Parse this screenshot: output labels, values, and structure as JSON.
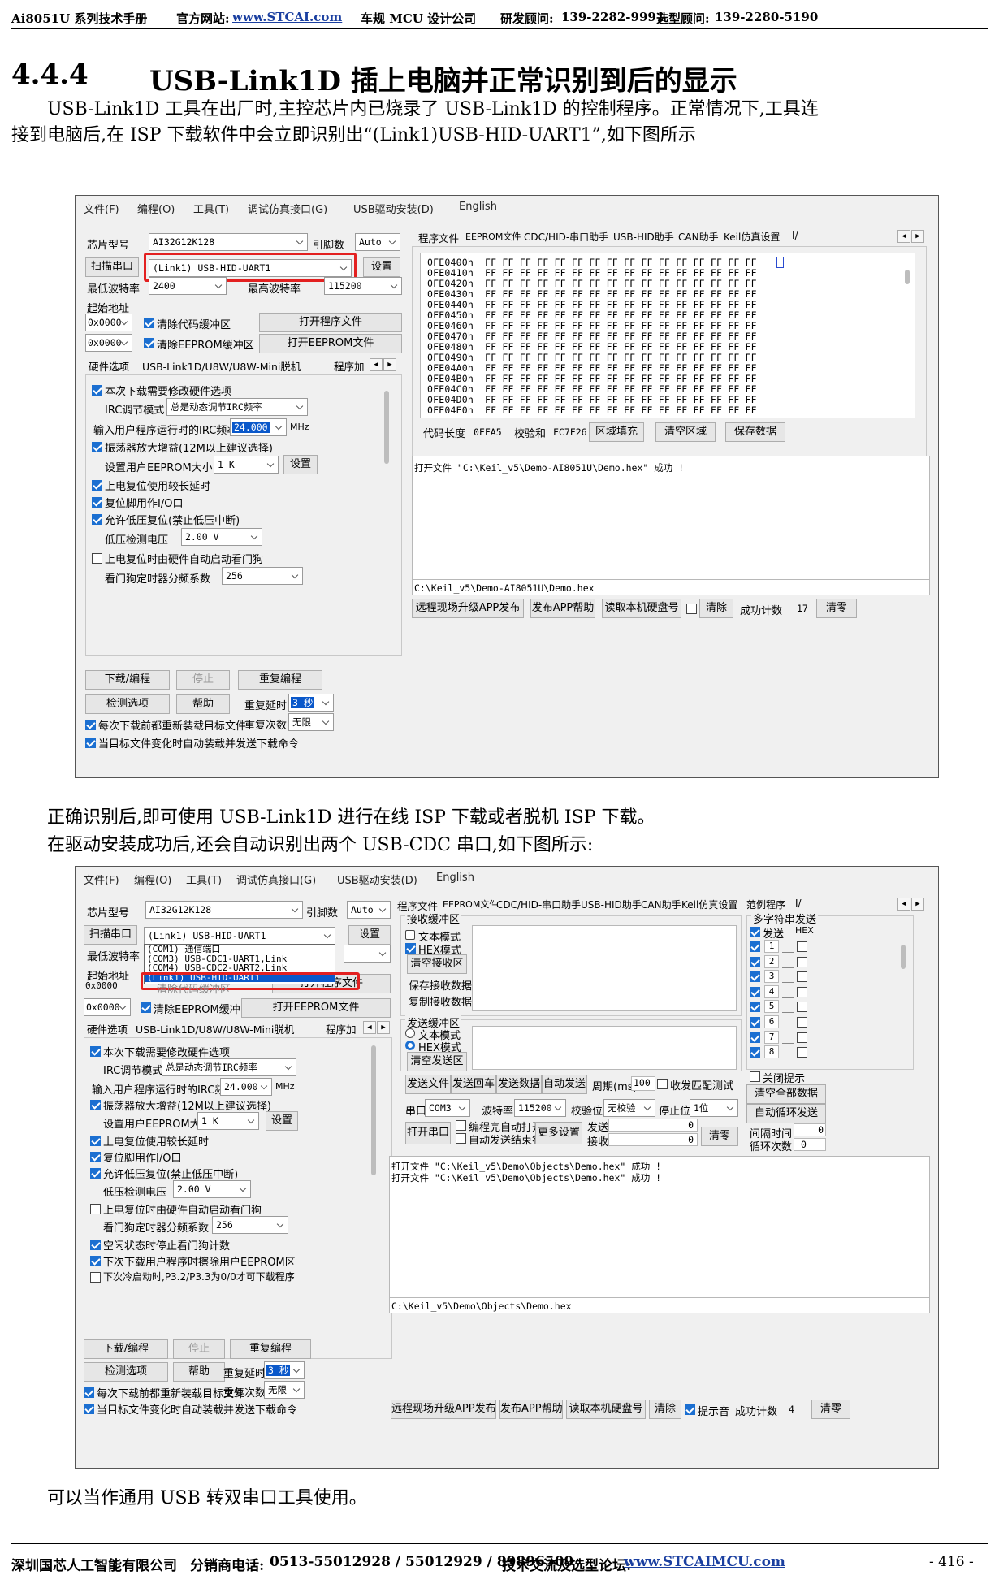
{
  "header": {
    "manual": "Ai8051U 系列技术手册",
    "site_label": "官方网站:",
    "site_url": "www.STCAI.com",
    "company": "车规 MCU 设计公司",
    "rd_label": "研发顾问:",
    "rd_phone": "139-2282-9991",
    "sel_label": "选型顾问:",
    "sel_phone": "139-2280-5190"
  },
  "section": {
    "number": "4.4.4",
    "title": "USB-Link1D 插上电脑并正常识别到后的显示"
  },
  "paragraphs": [
    "USB-Link1D 工具在出厂时,主控芯片内已烧录了 USB-Link1D 的控制程序。正常情况下,工具连",
    "接到电脑后,在 ISP 下载软件中会立即识别出“(Link1)USB-HID-UART1”,如下图所示",
    "正确识别后,即可使用 USB-Link1D 进行在线 ISP 下载或者脱机 ISP 下载。",
    "在驱动安装成功后,还会自动识别出两个 USB-CDC 串口,如下图所示:",
    "可以当作通用 USB 转双串口工具使用。"
  ],
  "footer": {
    "company": "深圳国芯人工智能有限公司",
    "phone_label": "分销商电话:",
    "phones": "0513-55012928 / 55012929 / 89896509",
    "forum_label": "技术交流及选型论坛:",
    "forum_url": "www.STCAIMCU.com",
    "page": "- 416 -"
  },
  "app": {
    "menu": [
      "文件(F)",
      "编程(O)",
      "工具(T)",
      "调试仿真接口(G)",
      "USB驱动安装(D)",
      "English"
    ],
    "chip_label": "芯片型号",
    "chip": "AI32G12K128",
    "pins_label": "引脚数",
    "pins": "Auto",
    "scan_btn": "扫描串口",
    "port": "(Link1) USB-HID-UART1",
    "settings_btn": "设置",
    "min_baud_label": "最低波特率",
    "min_baud": "2400",
    "max_baud_label": "最高波特率",
    "max_baud": "115200",
    "start_addr_label": "起始地址",
    "addr1": "0x0000",
    "clear_code": "清除代码缓冲区",
    "open_prog": "打开程序文件",
    "addr2": "0x0000",
    "clear_eeprom": "清除EEPROM缓冲区",
    "open_eeprom": "打开EEPROM文件",
    "hw_tabs": [
      "硬件选项",
      "USB-Link1D/U8W/U8W-Mini脱机",
      "程序加"
    ],
    "opt_modify": "本次下载需要修改硬件选项",
    "irc_mode_label": "IRC调节模式",
    "irc_mode": "总是动态调节IRC频率",
    "irc_freq_label": "输入用户程序运行时的IRC频率",
    "irc_freq": "24.000",
    "mhz": "MHz",
    "osc_gain": "振荡器放大增益(12M以上建议选择)",
    "eeprom_size_label": "设置用户EEPROM大小",
    "eeprom_size": "1 K",
    "set_btn": "设置",
    "long_delay": "上电复位使用较长延时",
    "reset_io": "复位脚用作I/O口",
    "lvd_reset": "允许低压复位(禁止低压中断)",
    "lvd_volt_label": "低压检测电压",
    "lvd_volt": "2.00 V",
    "wdt_auto": "上电复位时由硬件自动启动看门狗",
    "wdt_div_label": "看门狗定时器分频系数",
    "wdt_div": "256",
    "idle_wdt": "空闲状态时停止看门狗计数",
    "erase_eeprom": "下次下载用户程序时擦除用户EEPROM区",
    "cold_boot": "下次冷启动时,P3.2/P3.3为0/0才可下载程序",
    "download_btn": "下载/编程",
    "stop_btn": "停止",
    "reprogram_btn": "重复编程",
    "check_btn": "检测选项",
    "help_btn": "帮助",
    "repeat_delay_label": "重复延时",
    "repeat_delay": "3 秒",
    "reload_each": "每次下载前都重新装载目标文件",
    "repeat_count_label": "重复次数",
    "repeat_count": "无限",
    "auto_reload": "当目标文件变化时自动装载并发送下载命令",
    "right_tabs1": [
      "程序文件",
      "EEPROM文件",
      "CDC/HID-串口助手",
      "USB-HID助手",
      "CAN助手",
      "Keil仿真设置",
      "I/"
    ],
    "right_tabs2": [
      "程序文件",
      "EEPROM文件",
      "CDC/HID-串口助手",
      "USB-HID助手",
      "CAN助手",
      "Keil仿真设置",
      "范例程序",
      "I/"
    ],
    "hex_addrs": [
      "0FE0400h",
      "0FE0410h",
      "0FE0420h",
      "0FE0430h",
      "0FE0440h",
      "0FE0450h",
      "0FE0460h",
      "0FE0470h",
      "0FE0480h",
      "0FE0490h",
      "0FE04A0h",
      "0FE04B0h",
      "0FE04C0h",
      "0FE04D0h",
      "0FE04E0h"
    ],
    "hex_bytes": "FF FF FF FF FF FF FF FF FF FF FF FF FF FF FF FF",
    "code_len_label": "代码长度",
    "code_len": "0FFA5",
    "checksum_label": "校验和",
    "checksum": "FC7F26",
    "fill_btn": "区域填充",
    "clear_area_btn": "清空区域",
    "save_btn": "保存数据",
    "log1": "打开文件 \"C:\\Keil_v5\\Demo-AI8051U\\Demo.hex\" 成功 !",
    "path1": "C:\\Keil_v5\\Demo-AI8051U\\Demo.hex",
    "remote_btn": "远程现场升级APP发布",
    "publish_btn": "发布APP帮助",
    "read_disk_btn": "读取本机硬盘号",
    "read_disk_btn_short": "读取本机硬盘号",
    "clear_btn": "清除",
    "beep": "提示音",
    "count_label": "成功计数",
    "count1": "17",
    "count2": "4",
    "zero_btn": "清零",
    "ports_list": [
      "(COM1) 通信端口",
      "(COM3) USB-CDC1-UART1,Link",
      "(COM4) USB-CDC2-UART2,Link",
      "(Link1) USB-HID-UART1"
    ],
    "rx_label": "接收缓冲区",
    "text_mode": "文本模式",
    "hex_mode": "HEX模式",
    "clear_rx": "清空接收区",
    "save_rx": "保存接收数据",
    "copy_rx": "复制接收数据",
    "tx_label": "发送缓冲区",
    "clear_tx": "清空发送区",
    "multi_label": "多字符串发送",
    "send_col": "发送",
    "hex_col": "HEX",
    "multi_rows": [
      "1",
      "2",
      "3",
      "4",
      "5",
      "6",
      "7",
      "8"
    ],
    "close_tip": "关闭提示",
    "clear_all": "清空全部数据",
    "auto_loop": "自动循环发送",
    "interval_label": "间隔时间",
    "interval": "0",
    "loop_label": "循环次数",
    "loops": "0",
    "send_file": "发送文件",
    "send_cr": "发送回车",
    "send_data": "发送数据",
    "auto_send": "自动发送",
    "period_label": "周期(ms)",
    "period": "100",
    "match_test": "收发匹配测试",
    "port_label": "串口",
    "port_val": "COM3",
    "baud_label": "波特率",
    "baud_val": "115200",
    "parity_label": "校验位",
    "parity_val": "无校验",
    "stop_label": "停止位",
    "stop_val": "1位",
    "open_port": "打开串口",
    "auto_open": "编程完自动打开",
    "auto_send_end": "自动发送结束符",
    "more_set": "更多设置",
    "tx_cnt_label": "发送",
    "rx_cnt_label": "接收",
    "tx_cnt": "0",
    "rx_cnt": "0",
    "log2a": "打开文件 \"C:\\Keil_v5\\Demo\\Objects\\Demo.hex\" 成功 !",
    "log2b": "打开文件 \"C:\\Keil_v5\\Demo\\Objects\\Demo.hex\" 成功 !",
    "path2": "C:\\Keil_v5\\Demo\\Objects\\Demo.hex"
  }
}
